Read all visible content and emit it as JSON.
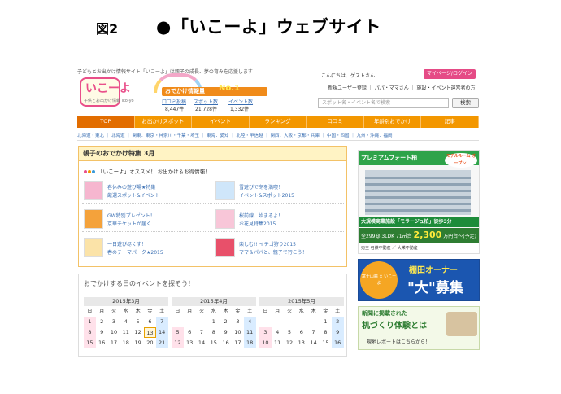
{
  "figure": {
    "label": "図2",
    "title": "●「いこーよ」ウェブサイト"
  },
  "site": {
    "tagline": "子どもとお出かけ情報サイト「いこーよ」は親子の成長、夢の育みを応援します！",
    "logo": {
      "main": "いこーよ",
      "sub": "子供とお出かけ情報 iko-yo"
    },
    "promo": {
      "text": "おでかけ情報量",
      "rank": "No.1"
    },
    "stats": [
      {
        "label": "口コミ投稿",
        "value": "8,447件"
      },
      {
        "label": "スポット数",
        "value": "21,728件"
      },
      {
        "label": "イベント数",
        "value": "1,332件"
      }
    ],
    "greeting": "こんにちは、ゲストさん",
    "login_button": "マイページ/ログイン",
    "register_text": "新規ユーザー登録 ｜ パパ・ママさん ｜ 施設・イベント運営者の方",
    "search_placeholder": "スポット名・イベント名で検索",
    "search_button": "検索",
    "nav": [
      "TOP",
      "お出かけスポット",
      "イベント",
      "ランキング",
      "口コミ",
      "年齢別おでかけ",
      "記事"
    ],
    "regions": "北海道・東北 ｜ 北海道 ｜ 関東：東京・神奈川・千葉・埼玉 ｜ 東海：愛知 ｜ 北陸・甲信越 ｜ 関西：大阪・京都・兵庫 ｜ 中国・四国 ｜ 九州・沖縄：福岡",
    "feature": {
      "heading": "親子のおでかけ特集 3月",
      "recommend": "「いこーよ」オススメ！ お出かけ＆お得情報！",
      "items": [
        {
          "line1": "春休みの遊び場★特集",
          "line2": "厳選スポット&イベント",
          "thumb_color": "#f6b6cf"
        },
        {
          "line1": "雪遊びで冬を満喫！",
          "line2": "イベント&スポット2015",
          "thumb_color": "#cfe6fa"
        },
        {
          "line1": "GW特別プレゼント！",
          "line2": "京華チケットが届く",
          "thumb_color": "#f4a23b"
        },
        {
          "line1": "桜前線、始まるよ！",
          "line2": "お花見特集2015",
          "thumb_color": "#f8c6d8"
        },
        {
          "line1": "一日遊び尽くす！",
          "line2": "春のテーマパーク★2015",
          "thumb_color": "#fbe3a8"
        },
        {
          "line1": "楽しむ!! イチゴ狩り2015",
          "line2": "ママ＆パパと、親子で行こう！",
          "thumb_color": "#e8506a"
        }
      ]
    },
    "calendar": {
      "heading": "おでかけする日のイベントを探そう！",
      "weekdays": [
        "日",
        "月",
        "火",
        "水",
        "木",
        "金",
        "土"
      ],
      "months": [
        {
          "title": "2015年3月",
          "rows": [
            [
              "1",
              "2",
              "3",
              "4",
              "5",
              "6",
              "7"
            ],
            [
              "8",
              "9",
              "10",
              "11",
              "12",
              "13",
              "14"
            ],
            [
              "15",
              "16",
              "17",
              "18",
              "19",
              "20",
              "21"
            ]
          ],
          "today": "13"
        },
        {
          "title": "2015年4月",
          "rows": [
            [
              "",
              "",
              "",
              "1",
              "2",
              "3",
              "4"
            ],
            [
              "5",
              "6",
              "7",
              "8",
              "9",
              "10",
              "11"
            ],
            [
              "12",
              "13",
              "14",
              "15",
              "16",
              "17",
              "18"
            ]
          ],
          "today": ""
        },
        {
          "title": "2015年5月",
          "rows": [
            [
              "",
              "",
              "",
              "",
              "",
              "1",
              "2"
            ],
            [
              "3",
              "4",
              "5",
              "6",
              "7",
              "8",
              "9"
            ],
            [
              "10",
              "11",
              "12",
              "13",
              "14",
              "15",
              "16"
            ]
          ],
          "today": ""
        }
      ]
    },
    "ads": {
      "ad1": {
        "title": "プレミアムフォート柏",
        "bubble": "モデルルーム オープン!",
        "band": "大規模商業施設「モラージュ柏」徒歩3分",
        "price_prefix": "全299邸 3LDK 71㎡台",
        "price": "2,300",
        "price_suffix": "万円台〜(予定)",
        "footer": "売主 名鉄不動産 ／ 大栄不動産"
      },
      "ad2": {
        "badge": "富士山麓 × いこーよ",
        "line1": "棚田オーナー",
        "line2": "\"大\"募集"
      },
      "ad3": {
        "line1": "新聞に掲載された",
        "line2": "机づくり体験とは",
        "line3": "現地レポートはこちらから！"
      }
    }
  }
}
